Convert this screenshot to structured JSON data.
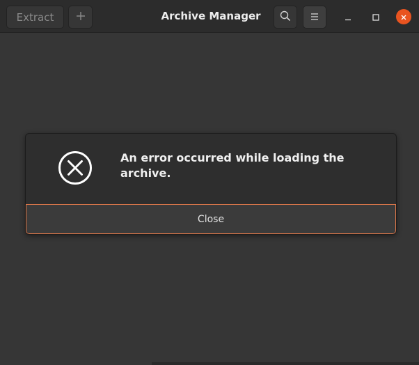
{
  "window": {
    "title": "Archive Manager"
  },
  "headerbar": {
    "extract_label": "Extract",
    "add_icon": "plus-icon",
    "search_icon": "search-icon",
    "menu_icon": "hamburger-menu-icon",
    "minimize_icon": "minimize-icon",
    "maximize_icon": "maximize-icon",
    "close_icon": "close-icon",
    "accent_color": "#e95420"
  },
  "dialog": {
    "icon": "error-circle-x-icon",
    "message": "An error occurred while loading the archive.",
    "close_label": "Close",
    "focus_border_color": "#e0784a"
  }
}
